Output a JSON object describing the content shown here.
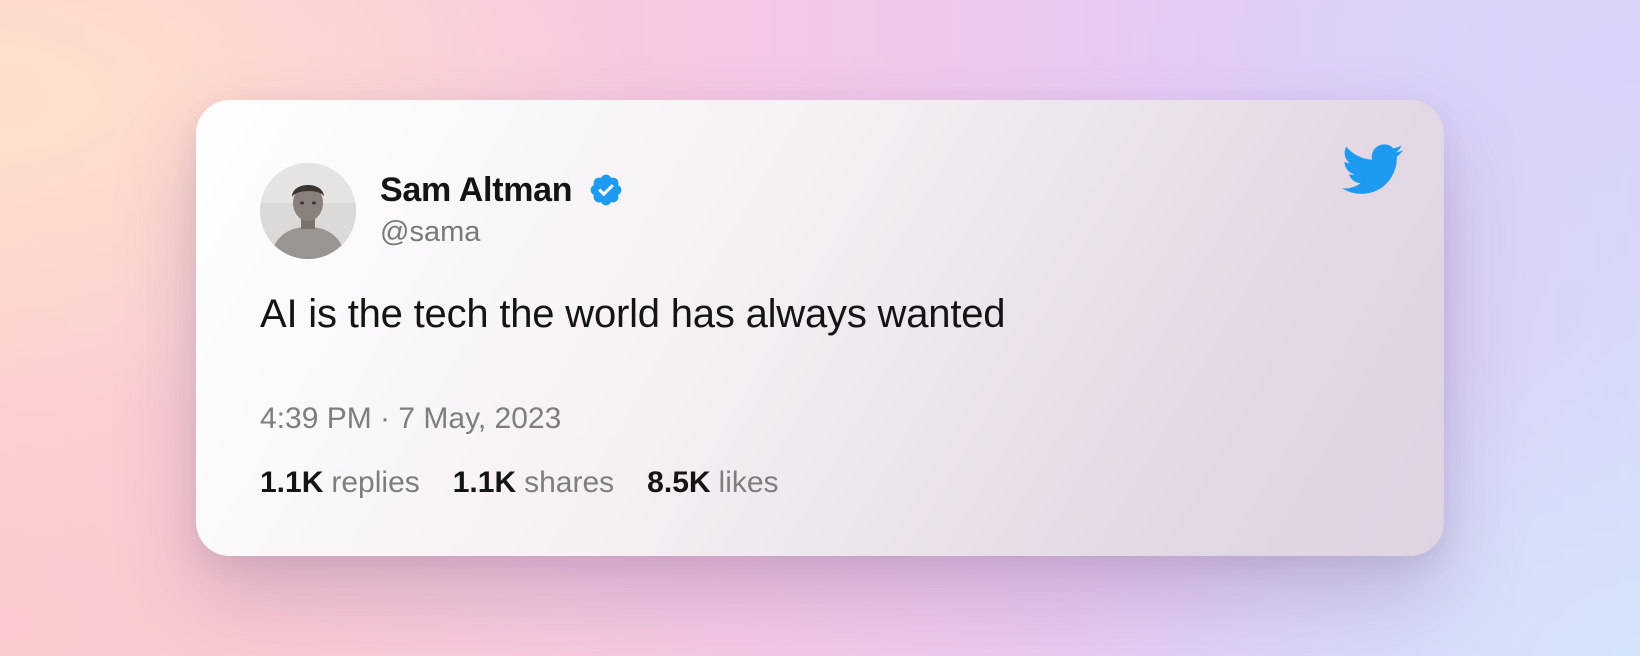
{
  "tweet": {
    "author": {
      "name": "Sam Altman",
      "handle": "@sama",
      "verified": true,
      "avatar": "profile-photo"
    },
    "text": "AI is the tech the world has always wanted",
    "timestamp": "4:39 PM · 7 May, 2023",
    "stats": {
      "replies": {
        "count": "1.1K",
        "label": "replies"
      },
      "shares": {
        "count": "1.1K",
        "label": "shares"
      },
      "likes": {
        "count": "8.5K",
        "label": "likes"
      }
    },
    "icons": {
      "verified": "verified-badge-icon",
      "brand": "twitter-bird-icon"
    },
    "colors": {
      "twitter_blue": "#1d9bf0",
      "text_primary": "#141414",
      "text_secondary": "#7e7e7e"
    }
  }
}
